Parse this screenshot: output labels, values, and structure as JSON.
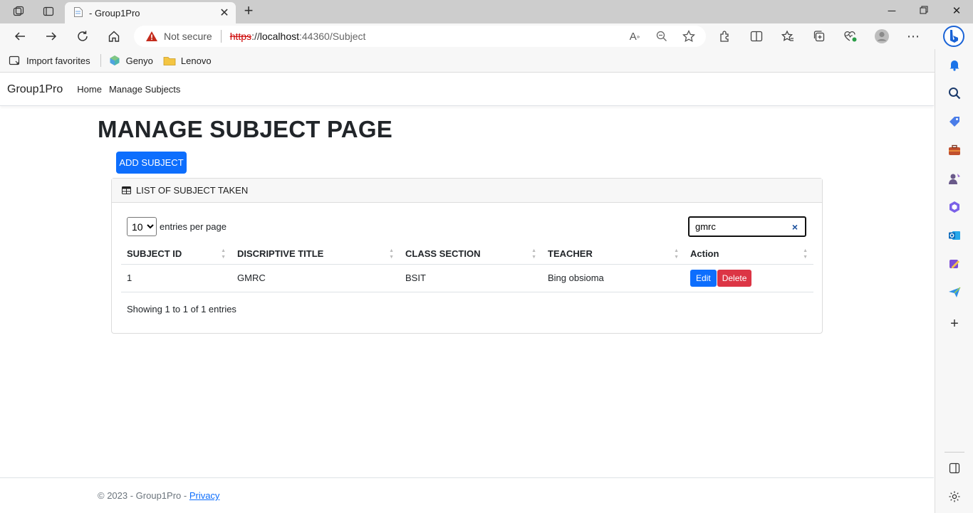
{
  "browser": {
    "tab_title": "- Group1Pro",
    "security_label": "Not secure",
    "url_scheme": "https",
    "url_sep": "://",
    "url_host": "localhost",
    "url_path": ":44360/Subject",
    "favorites": [
      {
        "label": "Import favorites",
        "icon": "import-icon"
      },
      {
        "label": "Genyo",
        "icon": "genyo-logo-icon"
      },
      {
        "label": "Lenovo",
        "icon": "folder-icon"
      }
    ]
  },
  "navbar": {
    "brand": "Group1Pro",
    "links": [
      "Home",
      "Manage Subjects"
    ]
  },
  "page": {
    "title": "MANAGE SUBJECT PAGE",
    "add_button": "ADD SUBJECT",
    "card_title": "LIST OF SUBJECT TAKEN"
  },
  "table": {
    "per_page_value": "10",
    "per_page_label": "entries per page",
    "search_value": "gmrc",
    "clear_glyph": "×",
    "headers": [
      "SUBJECT ID",
      "DISCRIPTIVE TITLE",
      "CLASS SECTION",
      "TEACHER",
      "Action"
    ],
    "rows": [
      {
        "id": "1",
        "title": "GMRC",
        "section": "BSIT",
        "teacher": "Bing obsioma"
      }
    ],
    "edit_label": "Edit",
    "delete_label": "Delete",
    "info": "Showing 1 to 1 of 1 entries"
  },
  "footer": {
    "text": "© 2023 - Group1Pro - ",
    "privacy": "Privacy"
  }
}
